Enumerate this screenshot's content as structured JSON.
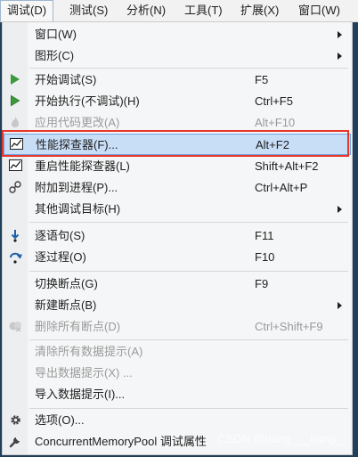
{
  "menubar": {
    "items": [
      "调试(D)",
      "测试(S)",
      "分析(N)",
      "工具(T)",
      "扩展(X)",
      "窗口(W)"
    ]
  },
  "menu": {
    "items": [
      {
        "label": "窗口(W)",
        "shortcut": "",
        "submenu": true,
        "icon": "",
        "disabled": false
      },
      {
        "label": "图形(C)",
        "shortcut": "",
        "submenu": true,
        "icon": "",
        "disabled": false
      },
      {
        "label": "开始调试(S)",
        "shortcut": "F5",
        "submenu": false,
        "icon": "play-icon",
        "disabled": false
      },
      {
        "label": "开始执行(不调试)(H)",
        "shortcut": "Ctrl+F5",
        "submenu": false,
        "icon": "play-outline-icon",
        "disabled": false
      },
      {
        "label": "应用代码更改(A)",
        "shortcut": "Alt+F10",
        "submenu": false,
        "icon": "flame-icon",
        "disabled": true
      },
      {
        "label": "性能探查器(F)...",
        "shortcut": "Alt+F2",
        "submenu": false,
        "icon": "performance-icon",
        "disabled": false
      },
      {
        "label": "重启性能探查器(L)",
        "shortcut": "Shift+Alt+F2",
        "submenu": false,
        "icon": "performance-icon",
        "disabled": false
      },
      {
        "label": "附加到进程(P)...",
        "shortcut": "Ctrl+Alt+P",
        "submenu": false,
        "icon": "attach-icon",
        "disabled": false
      },
      {
        "label": "其他调试目标(H)",
        "shortcut": "",
        "submenu": true,
        "icon": "",
        "disabled": false
      },
      {
        "label": "逐语句(S)",
        "shortcut": "F11",
        "submenu": false,
        "icon": "step-into-icon",
        "disabled": false
      },
      {
        "label": "逐过程(O)",
        "shortcut": "F10",
        "submenu": false,
        "icon": "step-over-icon",
        "disabled": false
      },
      {
        "label": "切换断点(G)",
        "shortcut": "F9",
        "submenu": false,
        "icon": "",
        "disabled": false
      },
      {
        "label": "新建断点(B)",
        "shortcut": "",
        "submenu": true,
        "icon": "",
        "disabled": false
      },
      {
        "label": "删除所有断点(D)",
        "shortcut": "Ctrl+Shift+F9",
        "submenu": false,
        "icon": "delete-breakpoints-icon",
        "disabled": true
      },
      {
        "label": "清除所有数据提示(A)",
        "shortcut": "",
        "submenu": false,
        "icon": "",
        "disabled": true
      },
      {
        "label": "导出数据提示(X) ...",
        "shortcut": "",
        "submenu": false,
        "icon": "",
        "disabled": true
      },
      {
        "label": "导入数据提示(I)...",
        "shortcut": "",
        "submenu": false,
        "icon": "",
        "disabled": false
      },
      {
        "label": "选项(O)...",
        "shortcut": "",
        "submenu": false,
        "icon": "gear-icon",
        "disabled": false
      },
      {
        "label": "ConcurrentMemoryPool 调试属性",
        "shortcut": "",
        "submenu": false,
        "icon": "wrench-icon",
        "disabled": false
      }
    ]
  },
  "watermark": "CSDN @bang___bang_"
}
